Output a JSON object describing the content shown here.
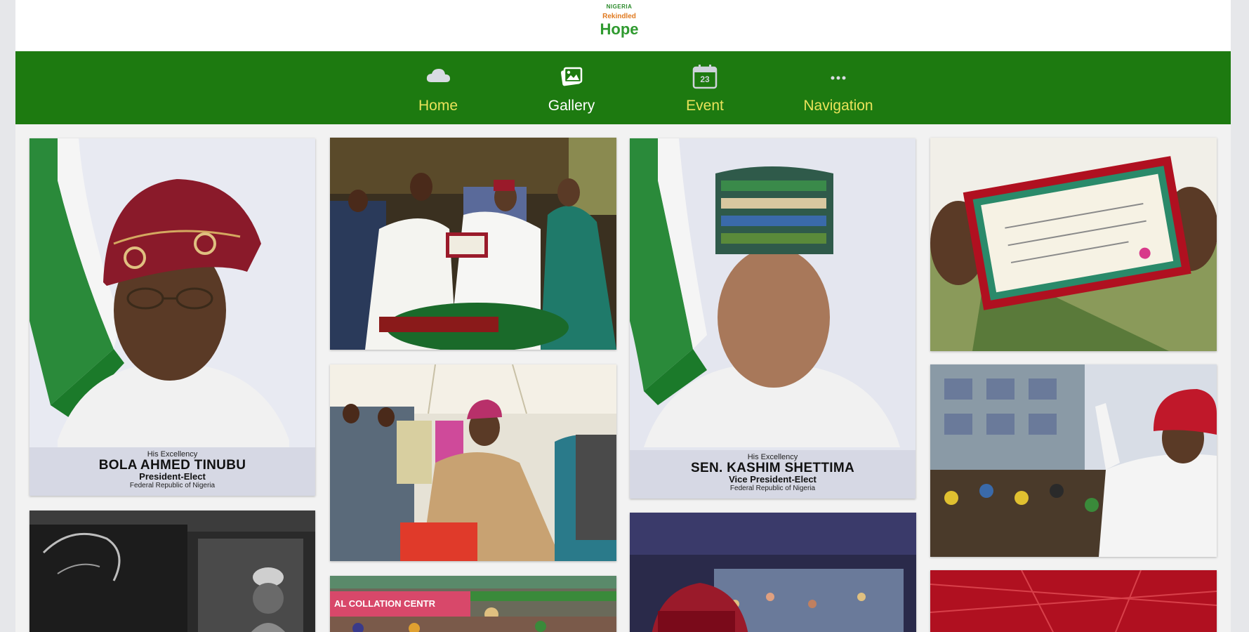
{
  "header": {
    "logo": {
      "line1": "NIGERIA",
      "line2": "Rekindled",
      "line3": "Hope",
      "icon": "renewed-hope-logo"
    }
  },
  "nav": {
    "items": [
      {
        "label": "Home",
        "icon": "cloud-icon"
      },
      {
        "label": "Gallery",
        "icon": "gallery-icon"
      },
      {
        "label": "Event",
        "icon": "calendar-icon",
        "calendar_day": "23"
      },
      {
        "label": "Navigation",
        "icon": "more-icon"
      }
    ]
  },
  "gallery": {
    "portrait_tinubu": {
      "honorific": "His Excellency",
      "name": "BOLA AHMED TINUBU",
      "title": "President-Elect",
      "subtitle": "Federal Republic of Nigeria"
    },
    "portrait_shettima": {
      "honorific": "His Excellency",
      "name": "SEN. KASHIM SHETTIMA",
      "title": "Vice President-Elect",
      "subtitle": "Federal Republic of Nigeria"
    },
    "collation_banner": "AL COLLATION CENTR"
  },
  "colors": {
    "nav_bg": "#1d7a10",
    "nav_label": "#e9e35a",
    "nav_label_active": "#ffffff",
    "caption_bg": "#d6d8e4"
  }
}
